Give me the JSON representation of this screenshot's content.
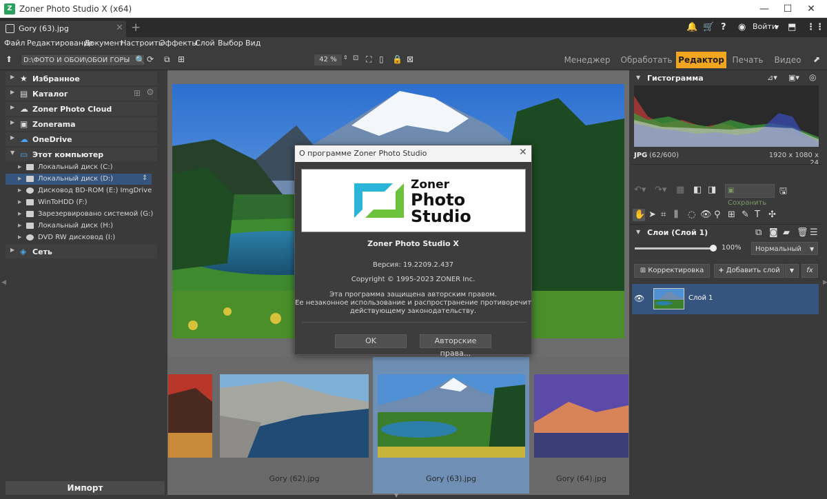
{
  "window": {
    "title": "Zoner Photo Studio X (x64)",
    "minimize": "—",
    "maximize": "☐",
    "close": "✕"
  },
  "tabs": {
    "active_label": "Gory (63).jpg",
    "close_glyph": "✕",
    "new_tab_glyph": "+"
  },
  "header": {
    "login_label": "Войти",
    "icons": [
      "bell-icon",
      "cart-icon",
      "help-icon",
      "user-icon",
      "screen-icon",
      "more-icon"
    ]
  },
  "menu": [
    "Файл",
    "Редактирование",
    "Документ",
    "Настроить",
    "Эффекты",
    "Слой",
    "Выбор",
    "Вид"
  ],
  "toolbar": {
    "path": "D:\\ФОТО И ОБОИ\\ОБОИ ГОРЫ",
    "zoom": "42 %"
  },
  "modes": {
    "items": [
      "Менеджер",
      "Обработать",
      "Редактор",
      "Печать",
      "Видео"
    ],
    "active": "Редактор"
  },
  "navigator": {
    "sections": [
      {
        "label": "Избранное",
        "icon": "star-icon"
      },
      {
        "label": "Каталог",
        "icon": "catalog-icon"
      },
      {
        "label": "Zoner Photo Cloud",
        "icon": "cloud-icon"
      },
      {
        "label": "Zonerama",
        "icon": "zonerama-icon"
      },
      {
        "label": "OneDrive",
        "icon": "onedrive-icon"
      },
      {
        "label": "Этот компьютер",
        "icon": "computer-icon"
      }
    ],
    "drives": [
      "Локальный диск (C:)",
      "Локальный диск (D:)",
      "Дисковод BD-ROM (E:) ImgDrive",
      "WinToHDD (F:)",
      "Зарезервировано системой (G:)",
      "Локальный диск (H:)",
      "DVD RW дисковод (I:)"
    ],
    "selected_drive": "Локальный диск (D:)",
    "network": "Сеть",
    "import_label": "Импорт"
  },
  "thumbnails": [
    {
      "label": ""
    },
    {
      "label": "Gory (62).jpg"
    },
    {
      "label": "Gory (63).jpg"
    },
    {
      "label": "Gory (64).jpg"
    }
  ],
  "dialog": {
    "title": "О программе Zoner Photo Studio",
    "logo_line1": "Zoner",
    "logo_line2": "Photo",
    "logo_line3": "Studio",
    "product": "Zoner Photo Studio X",
    "version": "Версия: 19.2209.2.437",
    "copyright": "Copyright © 1995-2023 ZONER Inc.",
    "legal_1": "Эта программа защищена авторским правом.",
    "legal_2": "Ее незаконное использование и распространение противоречит",
    "legal_3": "действующему законодательству.",
    "ok_label": "OK",
    "rights_label": "Авторские права..."
  },
  "histogram": {
    "title": "Гистограмма",
    "format": "JPG",
    "count": "(62/600)",
    "dimensions": "1920 x 1080 x 24"
  },
  "edit": {
    "save_label": "Сохранить"
  },
  "layers": {
    "title": "Слои (Слой 1)",
    "opacity": "100%",
    "opacity_fraction": 1.0,
    "blend_mode": "Нормальный",
    "correction_label": "Корректировка",
    "add_layer_label": "Добавить слой",
    "fx_label": "fx",
    "layer_name": "Слой 1"
  },
  "colors": {
    "accent": "#f2a51e",
    "selection": "#36557e"
  }
}
